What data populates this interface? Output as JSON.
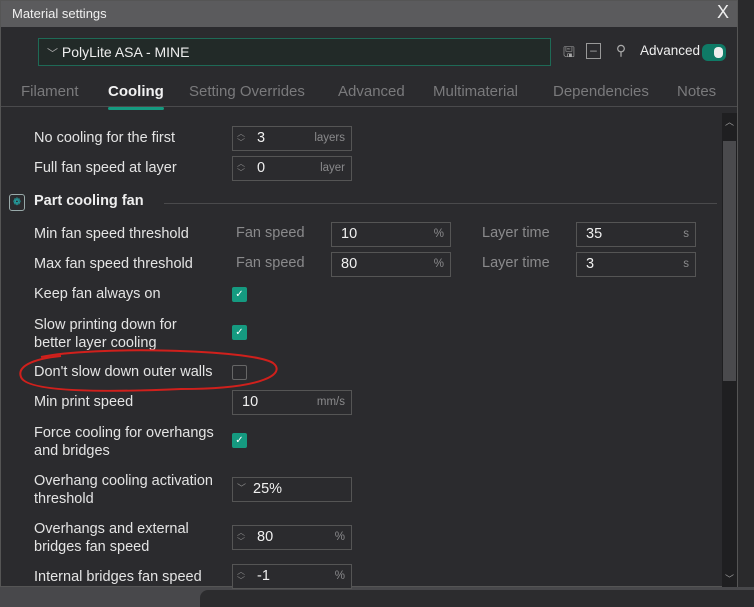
{
  "window": {
    "title": "Material settings",
    "close": "X"
  },
  "toolbar": {
    "preset": "PolyLite ASA - MINE",
    "advanced_label": "Advanced",
    "advanced_on": true
  },
  "tabs": [
    "Filament",
    "Cooling",
    "Setting Overrides",
    "Advanced",
    "Multimaterial",
    "Dependencies",
    "Notes"
  ],
  "active_tab": "Cooling",
  "rows": {
    "no_cooling": {
      "label": "No cooling for the first",
      "value": "3",
      "unit": "layers"
    },
    "full_fan": {
      "label": "Full fan speed at layer",
      "value": "0",
      "unit": "layer"
    },
    "section": "Part cooling fan",
    "min_fan": {
      "label": "Min fan speed threshold",
      "sub1": "Fan speed",
      "v1": "10",
      "u1": "%",
      "sub2": "Layer time",
      "v2": "35",
      "u2": "s"
    },
    "max_fan": {
      "label": "Max fan speed threshold",
      "sub1": "Fan speed",
      "v1": "80",
      "u1": "%",
      "sub2": "Layer time",
      "v2": "3",
      "u2": "s"
    },
    "keep_fan": {
      "label": "Keep fan always on",
      "checked": true
    },
    "slow_print": {
      "label1": "Slow printing down for",
      "label2": "better layer cooling",
      "checked": true
    },
    "dont_slow": {
      "label": "Don't slow down outer walls",
      "checked": false
    },
    "min_speed": {
      "label": "Min print speed",
      "value": "10",
      "unit": "mm/s"
    },
    "force_cool": {
      "label1": "Force cooling for overhangs",
      "label2": "and bridges",
      "checked": true
    },
    "overhang_thr": {
      "label1": "Overhang cooling activation",
      "label2": "threshold",
      "value": "25%"
    },
    "overhang_fan": {
      "label1": "Overhangs and external",
      "label2": "bridges fan speed",
      "value": "80",
      "unit": "%"
    },
    "internal_fan": {
      "label": "Internal bridges fan speed",
      "value": "-1",
      "unit": "%"
    }
  },
  "colors": {
    "accent": "#159a80",
    "annotation": "#d0201c"
  }
}
